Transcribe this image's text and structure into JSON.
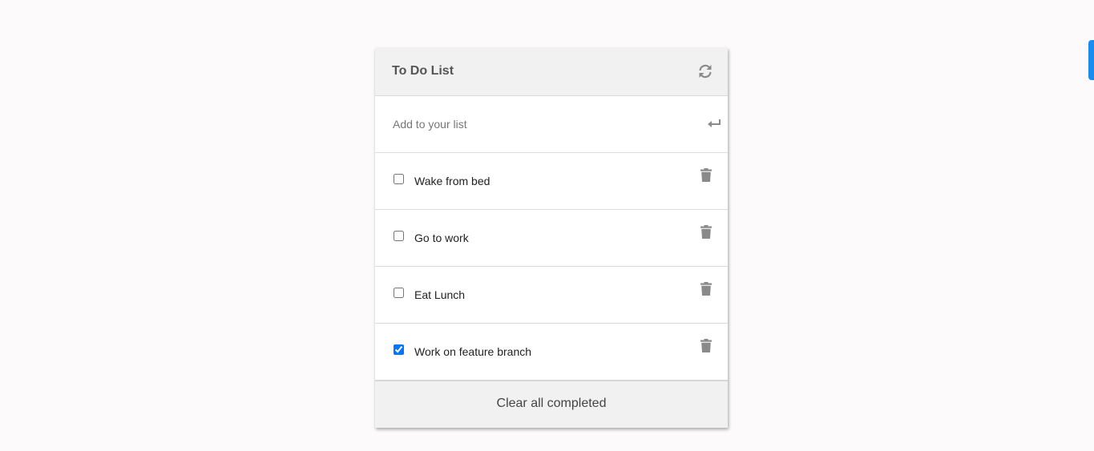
{
  "app": {
    "title": "To Do List"
  },
  "add": {
    "placeholder": "Add to your list"
  },
  "todos": [
    {
      "text": "Wake from bed",
      "completed": false
    },
    {
      "text": "Go to work",
      "completed": false
    },
    {
      "text": "Eat Lunch",
      "completed": false
    },
    {
      "text": "Work on feature branch",
      "completed": true
    }
  ],
  "footer": {
    "clear_label": "Clear all completed"
  },
  "icons": {
    "refresh": "refresh-icon",
    "enter": "enter-icon",
    "trash": "trash-icon"
  },
  "colors": {
    "accent": "#0075ff",
    "icon": "#8a8a8a",
    "side_tab": "#1a8cf0"
  }
}
